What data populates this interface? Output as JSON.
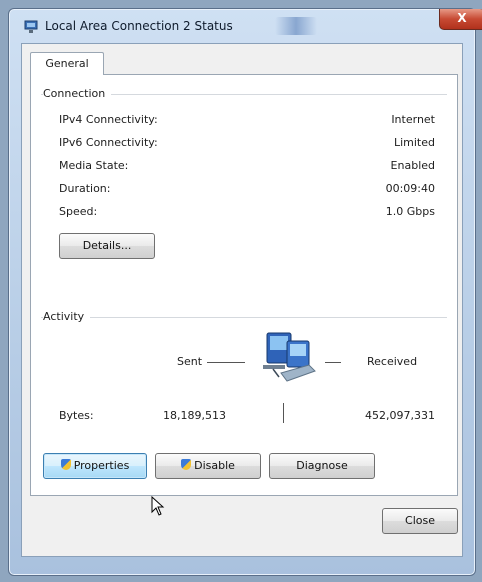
{
  "window": {
    "title": "Local Area Connection 2 Status",
    "close_glyph": "X"
  },
  "tabs": [
    {
      "label": "General"
    }
  ],
  "connection": {
    "heading": "Connection",
    "rows": [
      {
        "label": "IPv4 Connectivity:",
        "value": "Internet"
      },
      {
        "label": "IPv6 Connectivity:",
        "value": "Limited"
      },
      {
        "label": "Media State:",
        "value": "Enabled"
      },
      {
        "label": "Duration:",
        "value": "00:09:40"
      },
      {
        "label": "Speed:",
        "value": "1.0 Gbps"
      }
    ],
    "details_label": "Details..."
  },
  "activity": {
    "heading": "Activity",
    "sent_label": "Sent",
    "received_label": "Received",
    "bytes_label": "Bytes:",
    "bytes_sent": "18,189,513",
    "bytes_received": "452,097,331"
  },
  "buttons": {
    "properties": "Properties",
    "disable": "Disable",
    "diagnose": "Diagnose",
    "close": "Close"
  },
  "icons": {
    "title": "network-connection-icon",
    "activity": "network-computers-icon",
    "shield": "uac-shield-icon",
    "cursor": "mouse-pointer-icon"
  }
}
